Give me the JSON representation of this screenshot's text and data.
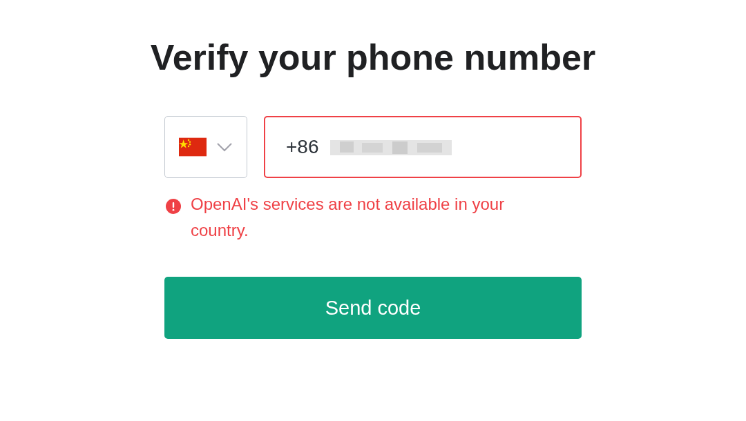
{
  "title": "Verify your phone number",
  "country_select": {
    "expanded": false
  },
  "phone_field": {
    "prefix": "+86",
    "redacted": true,
    "error": true
  },
  "error_message": "OpenAI's services are not available in your country.",
  "submit_button": "Send code"
}
